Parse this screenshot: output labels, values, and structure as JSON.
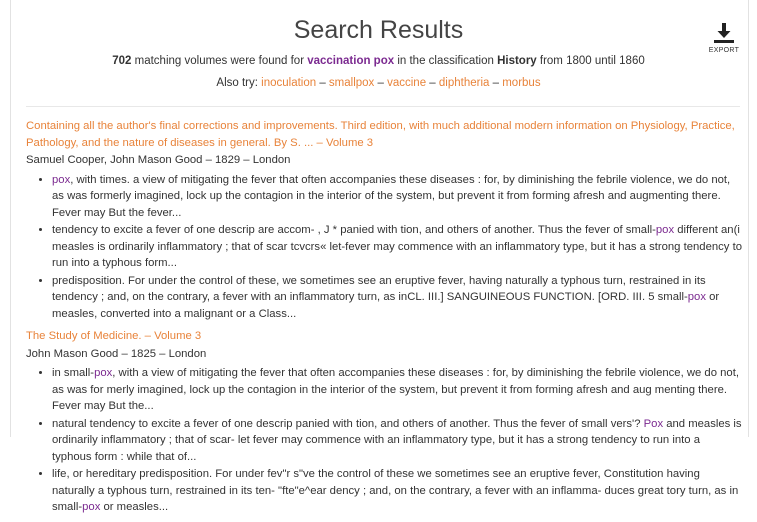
{
  "header": {
    "title": "Search Results",
    "export_label": "EXPORT",
    "summary": {
      "count_text": "702",
      "pre": " matching volumes were found for ",
      "query": "vaccination pox",
      "mid": " in the classification ",
      "classification": "History",
      "post": " from 1800 until 1860"
    },
    "also_try": {
      "label": "Also try: ",
      "terms": [
        "inoculation",
        "smallpox",
        "vaccine",
        "diphtheria",
        "morbus"
      ],
      "separator": " – "
    }
  },
  "results": [
    {
      "title": "Containing all the author's final corrections and improvements. Third edition, with much additional modern information on Physiology, Practice, Pathology, and the nature of diseases in general. By S. ...",
      "volume": "  –  Volume 3",
      "meta": "Samuel Cooper, John Mason Good – 1829 – London",
      "snippets": [
        [
          {
            "t": "pox",
            "h": true
          },
          {
            "t": ", with times. a view of mitigating the fever that often accompanies these diseases : for, by diminishing the febrile violence, we do not, as was formerly imagined, lock up the contagion in the interior of the system, but prevent it from forming afresh and augmenting there. Fever may But the fever...",
            "h": false
          }
        ],
        [
          {
            "t": "tendency to excite a fever of one descrip are accom- , J * panied with tion, and others of another. Thus the fever of small-",
            "h": false
          },
          {
            "t": "pox",
            "h": true
          },
          {
            "t": " different an(i measles is ordinarily inflammatory ; that of scar tcvcrs« let-fever may commence with an inflammatory type, but it has a strong tendency to run into a typhous form...",
            "h": false
          }
        ],
        [
          {
            "t": "predisposition. For under the control of these, we sometimes see an eruptive fever, having naturally a typhous turn, restrained in its tendency ; and, on the contrary, a fever with an inflammatory turn, as inCL. III.] SANGUINEOUS FUNCTION. [ORD. III. 5 small-",
            "h": false
          },
          {
            "t": "pox",
            "h": true
          },
          {
            "t": " or measles, converted into a malignant or a Class...",
            "h": false
          }
        ]
      ]
    },
    {
      "title": "The Study of Medicine.",
      "volume": "  –  Volume 3",
      "meta": "John Mason Good – 1825 – London",
      "snippets": [
        [
          {
            "t": "in small-",
            "h": false
          },
          {
            "t": "pox",
            "h": true
          },
          {
            "t": ", with a view of mitigating the fever that often accompanies these diseases : for, by diminishing the febrile violence, we do not, as was for merly imagined, lock up the contagion in the interior of the system, but prevent it from forming afresh and aug menting there. Fever may But the...",
            "h": false
          }
        ],
        [
          {
            "t": "natural tendency to excite a fever of one descrip panied with tion, and others of another. Thus the fever of small vers'? ",
            "h": false
          },
          {
            "t": "Pox",
            "h": true
          },
          {
            "t": " and measles is ordinarily inflammatory ; that of scar- let fever may commence with an inflammatory type, but it has a strong tendency to run into a typhous form : while that of...",
            "h": false
          }
        ],
        [
          {
            "t": "life, or hereditary predisposition. For under fev\"r s\"ve the control of these we sometimes see an eruptive fever, Constitution having naturally a typhous turn, restrained in its ten- \"fte\"e^ear dency ; and, on the contrary, a fever with an inflamma- duces great tory turn, as in small-",
            "h": false
          },
          {
            "t": "pox",
            "h": true
          },
          {
            "t": " or measles...",
            "h": false
          }
        ]
      ]
    }
  ]
}
